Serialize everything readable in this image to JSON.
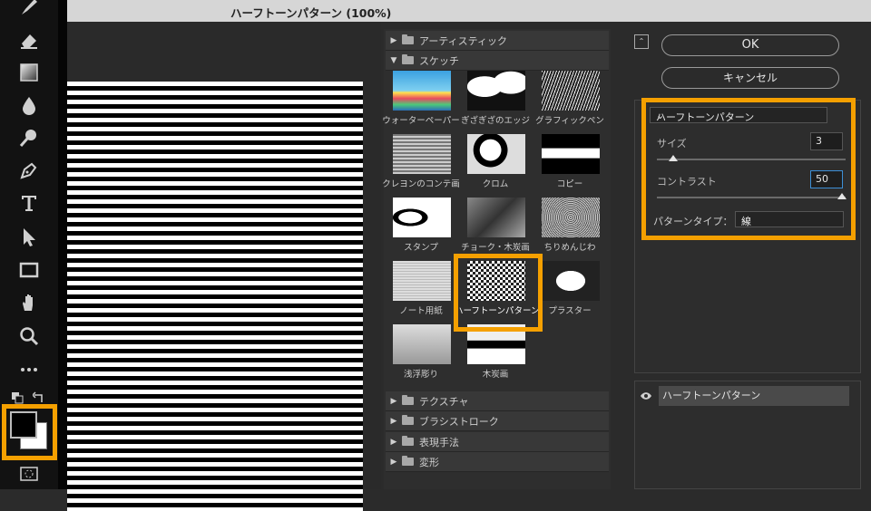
{
  "window": {
    "title": "ハーフトーンパターン (100%)"
  },
  "toolbar": {
    "tools": [
      "brush-icon",
      "eraser-icon",
      "gradient-icon",
      "blur-drop-icon",
      "dodge-icon",
      "pen-icon",
      "type-icon",
      "path-select-icon",
      "rectangle-icon",
      "hand-icon",
      "zoom-icon",
      "more-icon"
    ]
  },
  "gallery": {
    "categories_top": [
      {
        "label": "アーティスティック",
        "expanded": false
      },
      {
        "label": "スケッチ",
        "expanded": true
      }
    ],
    "sketch_filters": [
      {
        "label": "ウォーターペーパー"
      },
      {
        "label": "ぎざぎざのエッジ"
      },
      {
        "label": "グラフィックペン"
      },
      {
        "label": "クレヨンのコンテ画"
      },
      {
        "label": "クロム"
      },
      {
        "label": "コピー"
      },
      {
        "label": "スタンプ"
      },
      {
        "label": "チョーク・木炭画"
      },
      {
        "label": "ちりめんじわ"
      },
      {
        "label": "ノート用紙"
      },
      {
        "label": "ハーフトーンパターン",
        "selected": true
      },
      {
        "label": "プラスター"
      },
      {
        "label": "浅浮彫り"
      },
      {
        "label": "木炭画"
      }
    ],
    "categories_bottom": [
      {
        "label": "テクスチャ"
      },
      {
        "label": "ブラシストローク"
      },
      {
        "label": "表現手法"
      },
      {
        "label": "変形"
      }
    ]
  },
  "buttons": {
    "ok": "OK",
    "cancel": "キャンセル"
  },
  "settings": {
    "filter_name": "ハーフトーンパターン",
    "size_label": "サイズ",
    "size_value": "3",
    "size_fraction": 0.07,
    "contrast_label": "コントラスト",
    "contrast_value": "50",
    "contrast_fraction": 1.0,
    "pattern_type_label": "パターンタイプ：",
    "pattern_type_value": "線"
  },
  "layers": {
    "active_layer": "ハーフトーンパターン"
  },
  "colors": {
    "highlight": "#f5a000",
    "foreground": "#000000",
    "background": "#ffffff"
  }
}
